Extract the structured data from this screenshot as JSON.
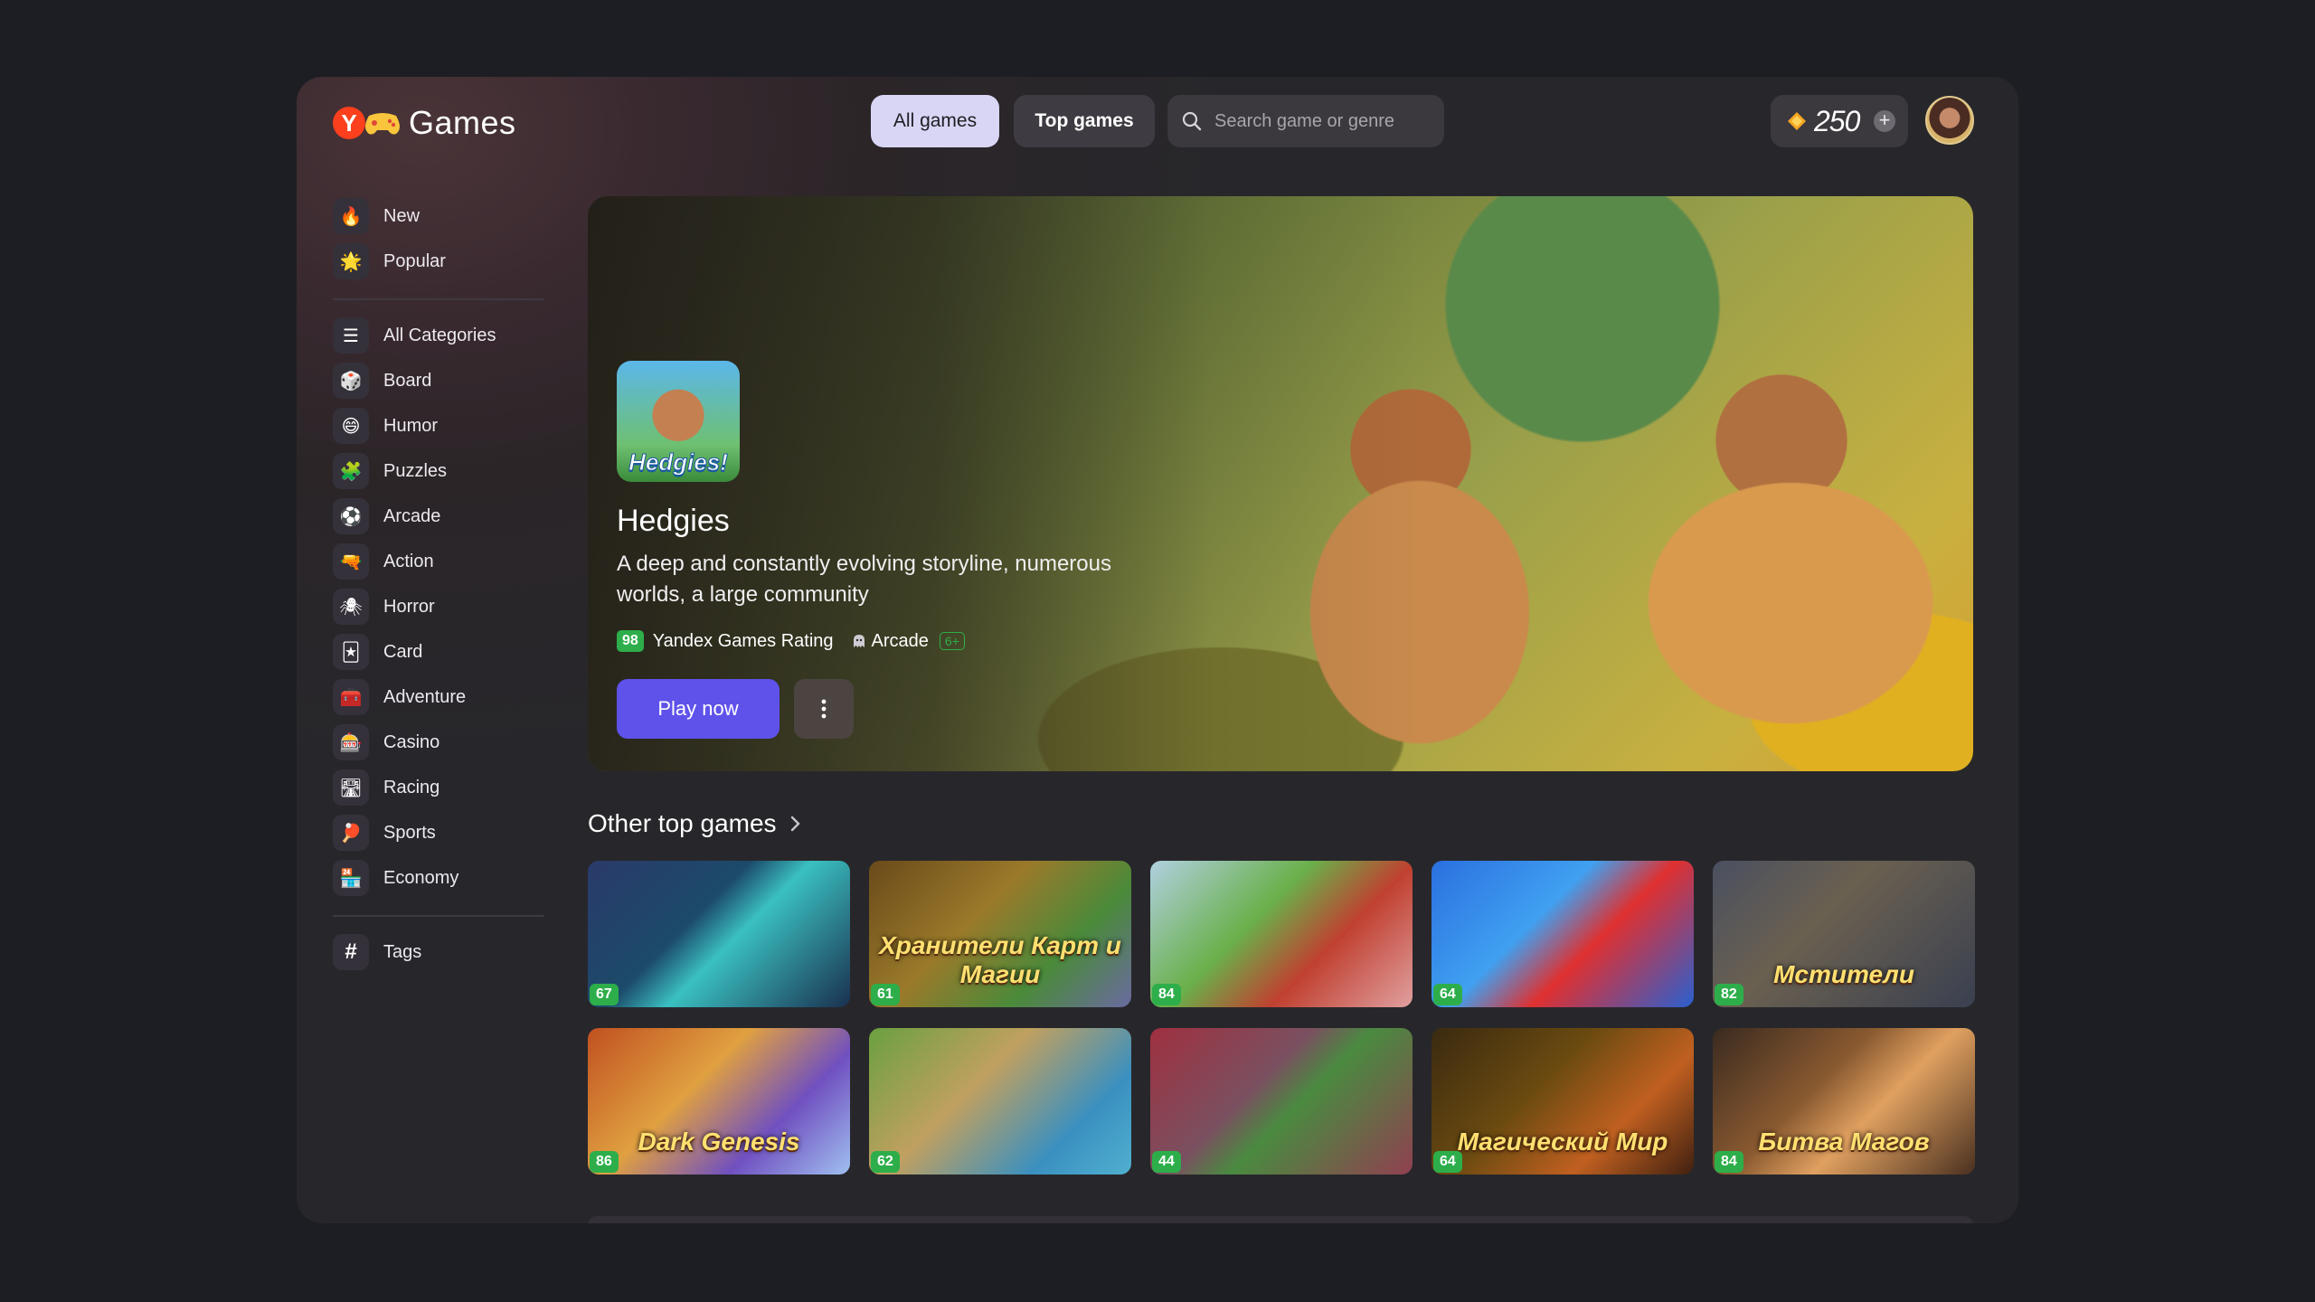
{
  "header": {
    "logo_text": "Games",
    "tabs": [
      {
        "label": "All games",
        "active": true
      },
      {
        "label": "Top games",
        "active": false
      }
    ],
    "search_placeholder": "Search game or genre",
    "coins": "250"
  },
  "sidebar": {
    "primary": [
      {
        "label": "New",
        "icon": "fire-icon",
        "glyph": "🔥"
      },
      {
        "label": "Popular",
        "icon": "sun-icon",
        "glyph": "🌟"
      }
    ],
    "categories": [
      {
        "label": "All Categories",
        "icon": "list-icon",
        "glyph": "☰"
      },
      {
        "label": "Board",
        "icon": "dice-icon",
        "glyph": "🎲"
      },
      {
        "label": "Humor",
        "icon": "smile-icon",
        "glyph": "😄"
      },
      {
        "label": "Puzzles",
        "icon": "puzzle-icon",
        "glyph": "🧩"
      },
      {
        "label": "Arcade",
        "icon": "ball-icon",
        "glyph": "⚽"
      },
      {
        "label": "Action",
        "icon": "gun-icon",
        "glyph": "🔫"
      },
      {
        "label": "Horror",
        "icon": "spider-icon",
        "glyph": "🕷"
      },
      {
        "label": "Card",
        "icon": "cards-icon",
        "glyph": "🃏"
      },
      {
        "label": "Adventure",
        "icon": "chest-icon",
        "glyph": "🧰"
      },
      {
        "label": "Casino",
        "icon": "slot-icon",
        "glyph": "🎰"
      },
      {
        "label": "Racing",
        "icon": "road-icon",
        "glyph": "🛣"
      },
      {
        "label": "Sports",
        "icon": "racket-icon",
        "glyph": "🏓"
      },
      {
        "label": "Economy",
        "icon": "store-icon",
        "glyph": "🏪"
      }
    ],
    "tags": {
      "label": "Tags",
      "icon": "hash-icon",
      "glyph": "#"
    }
  },
  "hero": {
    "thumb_text": "Hedgies!",
    "title": "Hedgies",
    "description": "A deep and constantly evolving storyline, numerous worlds, a large community",
    "rating": "98",
    "rating_label": "Yandex Games Rating",
    "genre": "Arcade",
    "age": "6+",
    "play_label": "Play now"
  },
  "section": {
    "title": "Other top games"
  },
  "games": [
    {
      "rating": "67",
      "title": "",
      "bg": "linear-gradient(135deg,#2a3a6a 0%,#1c4a6a 40%,#3ac0c0 55%,#1a3050 100%)"
    },
    {
      "rating": "61",
      "title": "Хранители Карт и Магии",
      "bg": "linear-gradient(135deg,#6a4a1a 0%,#9a7a2a 40%,#4a8a3a 70%,#6a6aa0 100%)"
    },
    {
      "rating": "84",
      "title": "",
      "bg": "linear-gradient(135deg,#b0d0e0 0%,#6ab04a 40%,#c04030 65%,#e0a0a0 100%)"
    },
    {
      "rating": "64",
      "title": "",
      "bg": "linear-gradient(135deg,#2a70e0 0%,#40a0f0 40%,#e03030 60%,#2a60d0 100%)"
    },
    {
      "rating": "82",
      "title": "Мстители",
      "bg": "linear-gradient(135deg,#4a5060 0%,#6a6050 40%,#3a4050 100%)"
    },
    {
      "rating": "86",
      "title": "Dark Genesis",
      "bg": "linear-gradient(135deg,#c05020 0%,#e0a040 40%,#7050c0 70%,#a0c0f0 100%)"
    },
    {
      "rating": "62",
      "title": "",
      "bg": "linear-gradient(135deg,#6aa040 0%,#c0a060 40%,#3a90c0 75%,#50b0d0 100%)"
    },
    {
      "rating": "44",
      "title": "",
      "bg": "linear-gradient(135deg,#a03040 0%,#7a5060 40%,#4a8a40 55%,#904050 100%)"
    },
    {
      "rating": "64",
      "title": "Магический Мир",
      "bg": "linear-gradient(135deg,#3a2a10 0%,#6a4a10 40%,#c06020 70%,#402010 100%)"
    },
    {
      "rating": "84",
      "title": "Битва Магов",
      "bg": "linear-gradient(135deg,#3a2a20 0%,#8a5a30 40%,#e0a060 60%,#4a3020 100%)"
    }
  ],
  "colors": {
    "accent": "#5f52ea",
    "rating_green": "#2dae4a",
    "background": "#1d1e23",
    "panel": "#27272b"
  }
}
